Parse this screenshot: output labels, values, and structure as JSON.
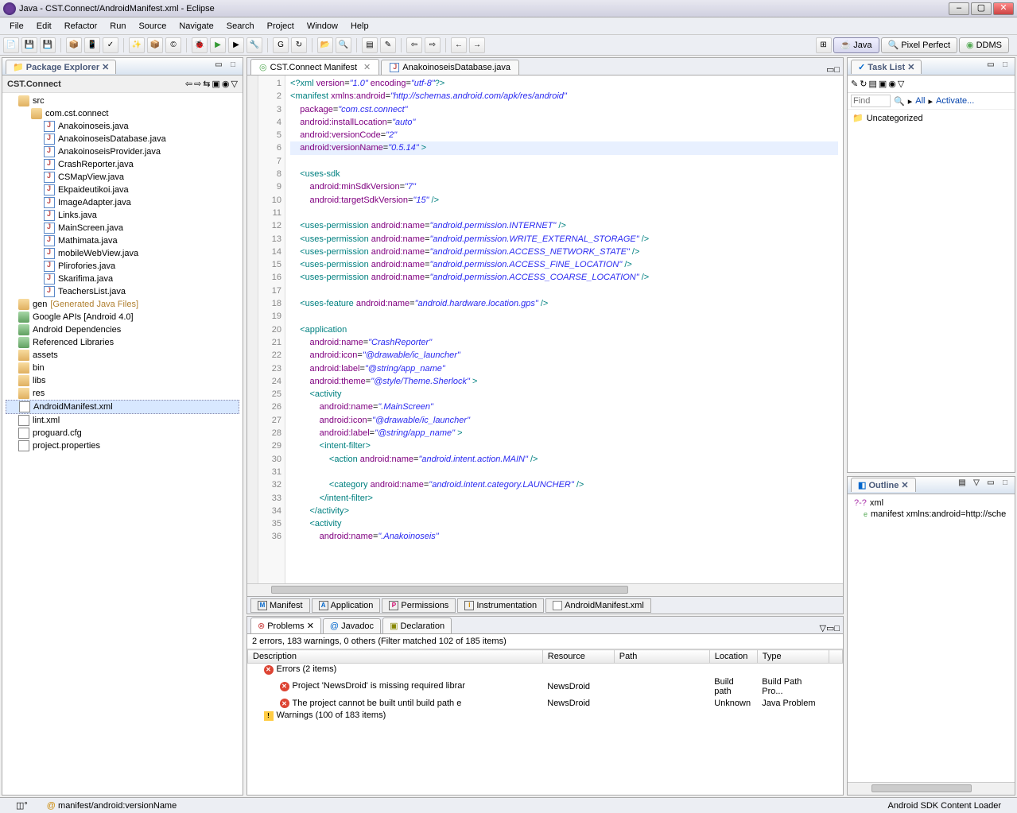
{
  "window": {
    "title": "Java - CST.Connect/AndroidManifest.xml - Eclipse"
  },
  "menu": [
    "File",
    "Edit",
    "Refactor",
    "Run",
    "Source",
    "Navigate",
    "Search",
    "Project",
    "Window",
    "Help"
  ],
  "perspectives": {
    "java": "Java",
    "pixel": "Pixel Perfect",
    "ddms": "DDMS"
  },
  "packageExplorer": {
    "title": "Package Explorer",
    "project": "CST.Connect",
    "src": "src",
    "pkg": "com.cst.connect",
    "javaFiles": [
      "Anakoinoseis.java",
      "AnakoinoseisDatabase.java",
      "AnakoinoseisProvider.java",
      "CrashReporter.java",
      "CSMapView.java",
      "Ekpaideutikoi.java",
      "ImageAdapter.java",
      "Links.java",
      "MainScreen.java",
      "Mathimata.java",
      "mobileWebView.java",
      "Plirofories.java",
      "Skarifima.java",
      "TeachersList.java"
    ],
    "gen": "gen",
    "genNote": "[Generated Java Files]",
    "googleApis": "Google APIs [Android 4.0]",
    "androidDeps": "Android Dependencies",
    "refLibs": "Referenced Libraries",
    "folders": [
      "assets",
      "bin",
      "libs",
      "res"
    ],
    "manifest": "AndroidManifest.xml",
    "lint": "lint.xml",
    "proguard": "proguard.cfg",
    "projprops": "project.properties"
  },
  "editorTabs": {
    "t1": "CST.Connect Manifest",
    "t2": "AnakoinoseisDatabase.java"
  },
  "bottomTabs": {
    "manifest": "Manifest",
    "application": "Application",
    "permissions": "Permissions",
    "instrumentation": "Instrumentation",
    "xml": "AndroidManifest.xml"
  },
  "code": {
    "l1a": "<?",
    "l1b": "xml",
    "l1c": " version",
    "l1d": "=",
    "l1e": "\"1.0\"",
    "l1f": " encoding",
    "l1g": "=",
    "l1h": "\"utf-8\"",
    "l1i": "?>",
    "l2a": "<",
    "l2b": "manifest",
    "l2c": " xmlns:android",
    "l2d": "=",
    "l2e": "\"http://schemas.android.com/apk/res/android\"",
    "l3a": "    package",
    "l3b": "=",
    "l3c": "\"com.cst.connect\"",
    "l4a": "    android:installLocation",
    "l4b": "=",
    "l4c": "\"auto\"",
    "l5a": "    android:versionCode",
    "l5b": "=",
    "l5c": "\"2\"",
    "l6a": "    android:versionName",
    "l6b": "=",
    "l6c": "\"0.5.14\"",
    "l6d": " >",
    "l8a": "    <",
    "l8b": "uses-sdk",
    "l9a": "        android:minSdkVersion",
    "l9b": "=",
    "l9c": "\"7\"",
    "l10a": "        android:targetSdkVersion",
    "l10b": "=",
    "l10c": "\"15\"",
    "l10d": " />",
    "l12a": "    <",
    "l12b": "uses-permission",
    "l12c": " android:name",
    "l12d": "=",
    "l12e": "\"android.permission.INTERNET\"",
    "l12f": " />",
    "l13e": "\"android.permission.WRITE_EXTERNAL_STORAGE\"",
    "l14e": "\"android.permission.ACCESS_NETWORK_STATE\"",
    "l15e": "\"android.permission.ACCESS_FINE_LOCATION\"",
    "l16e": "\"android.permission.ACCESS_COARSE_LOCATION\"",
    "l18a": "    <",
    "l18b": "uses-feature",
    "l18c": " android:name",
    "l18d": "=",
    "l18e": "\"android.hardware.location.gps\"",
    "l18f": " />",
    "l20a": "    <",
    "l20b": "application",
    "l21a": "        android:name",
    "l21b": "=",
    "l21c": "\"CrashReporter\"",
    "l22a": "        android:icon",
    "l22b": "=",
    "l22c": "\"@drawable/ic_launcher\"",
    "l23a": "        android:label",
    "l23b": "=",
    "l23c": "\"@string/app_name\"",
    "l24a": "        android:theme",
    "l24b": "=",
    "l24c": "\"@style/Theme.Sherlock\"",
    "l24d": " >",
    "l25a": "        <",
    "l25b": "activity",
    "l26a": "            android:name",
    "l26b": "=",
    "l26c": "\".MainScreen\"",
    "l27a": "            android:icon",
    "l27b": "=",
    "l27c": "\"@drawable/ic_launcher\"",
    "l28a": "            android:label",
    "l28b": "=",
    "l28c": "\"@string/app_name\"",
    "l28d": " >",
    "l29a": "            <",
    "l29b": "intent-filter",
    "l29c": ">",
    "l30a": "                <",
    "l30b": "action",
    "l30c": " android:name",
    "l30d": "=",
    "l30e": "\"android.intent.action.MAIN\"",
    "l30f": " />",
    "l32a": "                <",
    "l32b": "category",
    "l32c": " android:name",
    "l32d": "=",
    "l32e": "\"android.intent.category.LAUNCHER\"",
    "l32f": " />",
    "l33a": "            </",
    "l33b": "intent-filter",
    "l33c": ">",
    "l34a": "        </",
    "l34b": "activity",
    "l34c": ">",
    "l35a": "        <",
    "l35b": "activity",
    "l36a": "            android:name",
    "l36b": "=",
    "l36c": "\".Anakoinoseis\""
  },
  "problems": {
    "tab1": "Problems",
    "tab2": "Javadoc",
    "tab3": "Declaration",
    "summary": "2 errors, 183 warnings, 0 others (Filter matched 102 of 185 items)",
    "cols": {
      "desc": "Description",
      "res": "Resource",
      "path": "Path",
      "loc": "Location",
      "type": "Type"
    },
    "errors": "Errors (2 items)",
    "e1": {
      "d": "Project 'NewsDroid' is missing required librar",
      "r": "NewsDroid",
      "l": "Build path",
      "t": "Build Path Pro..."
    },
    "e2": {
      "d": "The project cannot be built until build path e",
      "r": "NewsDroid",
      "l": "Unknown",
      "t": "Java Problem"
    },
    "warnings": "Warnings (100 of 183 items)"
  },
  "tasklist": {
    "title": "Task List",
    "find": "Find",
    "all": "All",
    "activate": "Activate...",
    "uncat": "Uncategorized"
  },
  "outline": {
    "title": "Outline",
    "root": "xml",
    "manifest": "manifest xmlns:android=http://sche"
  },
  "status": {
    "path": "manifest/android:versionName",
    "right": "Android SDK Content Loader"
  }
}
